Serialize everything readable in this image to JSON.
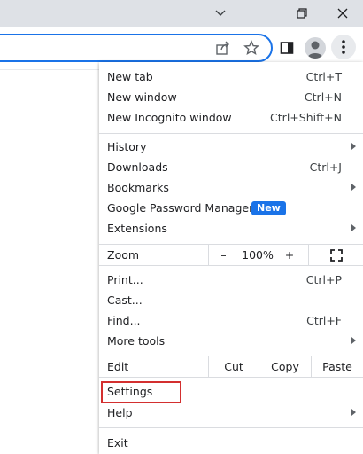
{
  "window": {
    "controls": [
      "chevron-down",
      "restore",
      "close"
    ]
  },
  "toolbar": {
    "icons": [
      "share-icon",
      "star-icon",
      "side-panel-icon",
      "profile-icon",
      "menu-icon"
    ]
  },
  "menu": {
    "new_tab": {
      "label": "New tab",
      "shortcut": "Ctrl+T"
    },
    "new_window": {
      "label": "New window",
      "shortcut": "Ctrl+N"
    },
    "new_incognito": {
      "label": "New Incognito window",
      "shortcut": "Ctrl+Shift+N"
    },
    "history": {
      "label": "History"
    },
    "downloads": {
      "label": "Downloads",
      "shortcut": "Ctrl+J"
    },
    "bookmarks": {
      "label": "Bookmarks"
    },
    "password_manager": {
      "label": "Google Password Manager",
      "badge": "New"
    },
    "extensions": {
      "label": "Extensions"
    },
    "zoom": {
      "label": "Zoom",
      "minus": "–",
      "value": "100%",
      "plus": "+"
    },
    "print": {
      "label": "Print...",
      "shortcut": "Ctrl+P"
    },
    "cast": {
      "label": "Cast..."
    },
    "find": {
      "label": "Find...",
      "shortcut": "Ctrl+F"
    },
    "more_tools": {
      "label": "More tools"
    },
    "edit": {
      "label": "Edit",
      "cut": "Cut",
      "copy": "Copy",
      "paste": "Paste"
    },
    "settings": {
      "label": "Settings"
    },
    "help": {
      "label": "Help"
    },
    "exit": {
      "label": "Exit"
    }
  },
  "colors": {
    "accent": "#1a73e8",
    "highlight": "#d32f2f",
    "titlebar": "#dee1e6"
  }
}
